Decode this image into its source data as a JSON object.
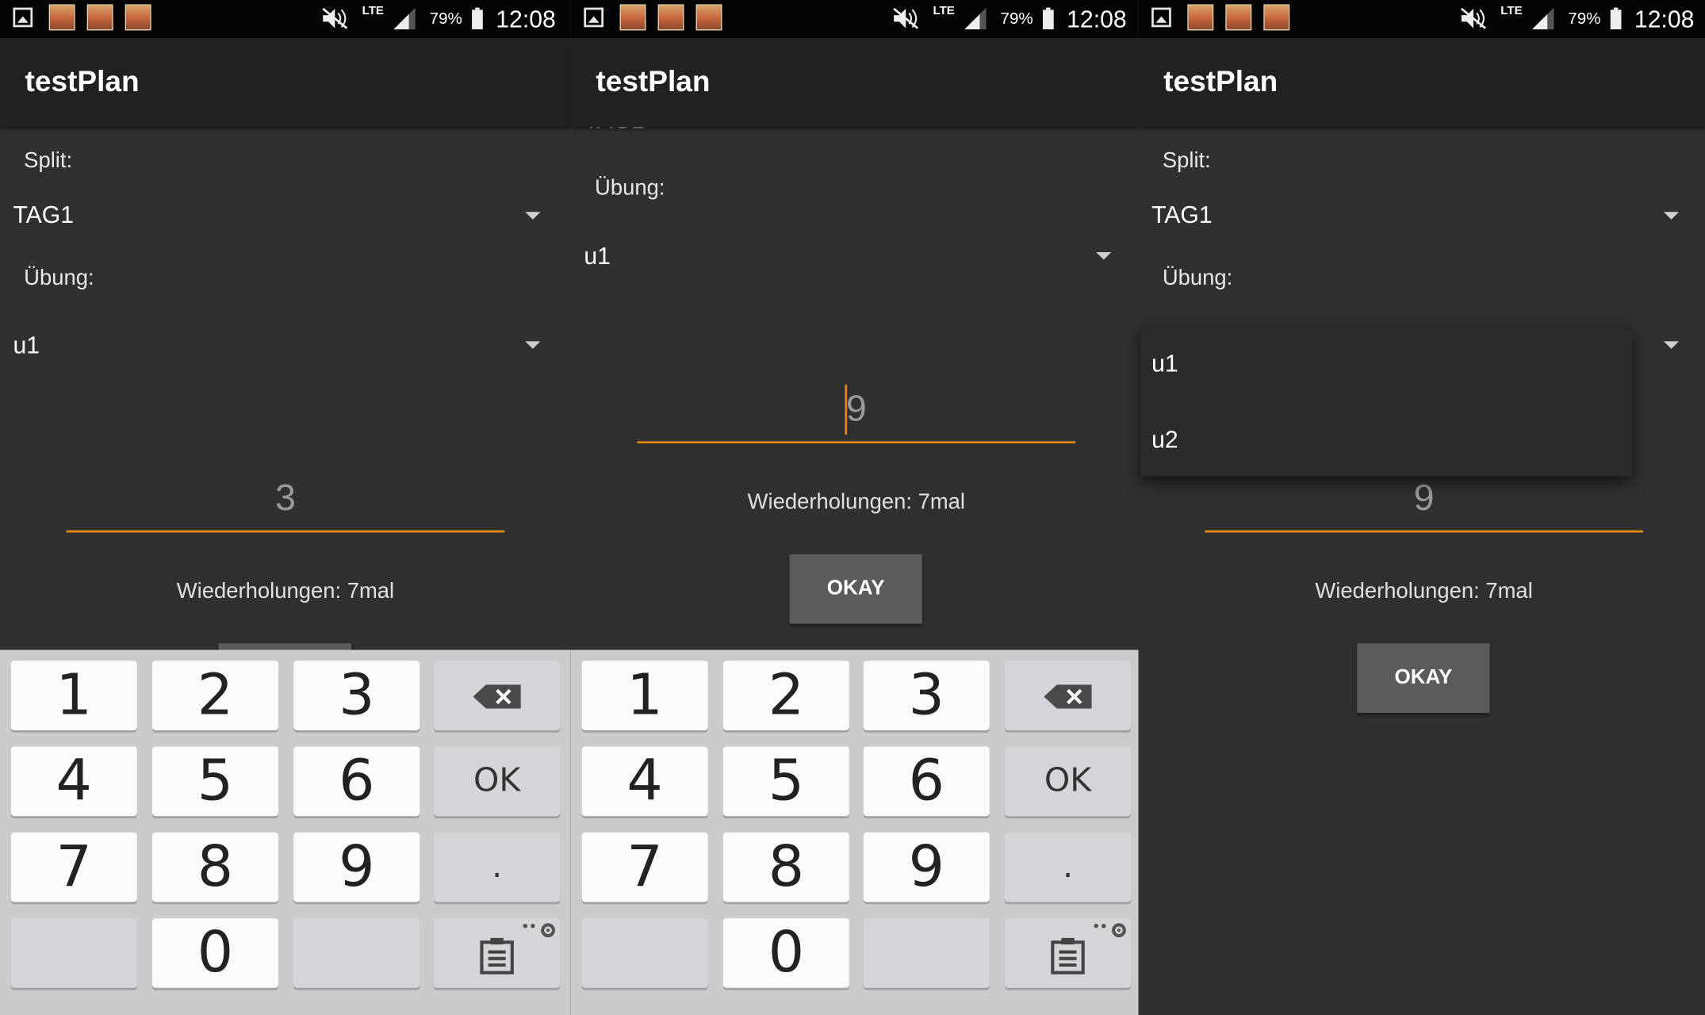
{
  "status_bar": {
    "network": "LTE",
    "battery_percent": "79%",
    "time": "12:08"
  },
  "app": {
    "title": "testPlan"
  },
  "form": {
    "split_label": "Split:",
    "split_value": "TAG1",
    "split_value_clipped": "TAG1",
    "uebung_label": "Übung:",
    "uebung_value": "u1",
    "wiederholungen_text": "Wiederholungen: 7mal",
    "okay_button": "OKAY"
  },
  "panels": [
    {
      "id": "left",
      "input_value": "3"
    },
    {
      "id": "middle",
      "input_value": "9"
    },
    {
      "id": "right",
      "input_value": "9"
    }
  ],
  "dropdown": {
    "options": [
      "u1",
      "u2"
    ]
  },
  "keyboard": {
    "keys": [
      "1",
      "2",
      "3",
      "4",
      "5",
      "6",
      "7",
      "8",
      "9",
      "0",
      "."
    ],
    "ok_key": "OK",
    "backspace_icon": "backspace-icon",
    "clipboard_icon": "clipboard-icon"
  },
  "colors": {
    "accent": "#e38a16",
    "background": "#303030",
    "appbar": "#212121",
    "statusbar": "#050505",
    "button": "#5b5b5b",
    "keyboard": "#c9cbcd"
  }
}
